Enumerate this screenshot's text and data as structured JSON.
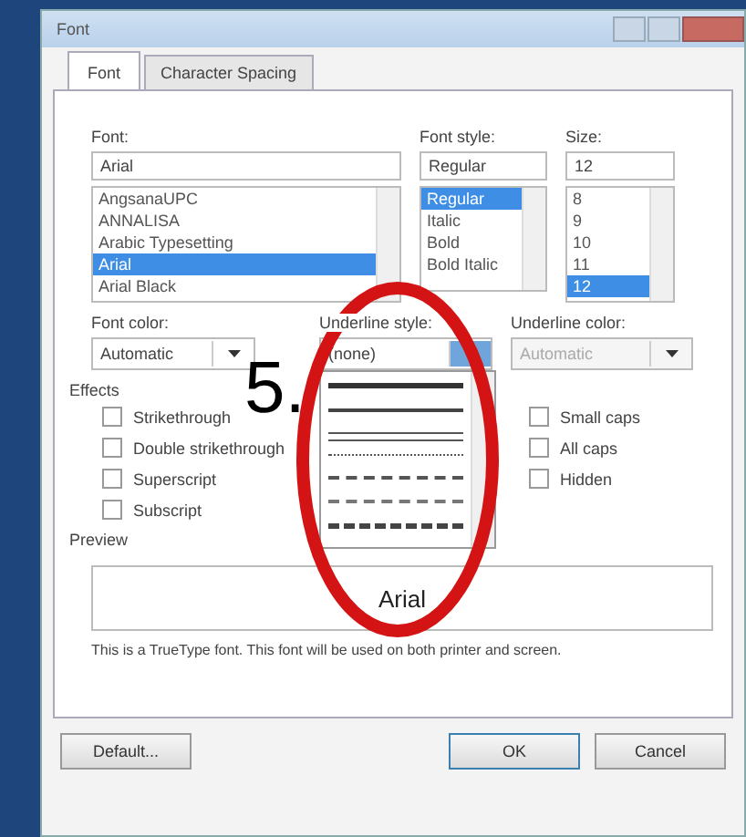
{
  "window": {
    "title": "Font"
  },
  "tabs": [
    {
      "label": "Font",
      "selected": true
    },
    {
      "label": "Character Spacing",
      "selected": false
    }
  ],
  "font": {
    "label": "Font:",
    "value": "Arial",
    "items": [
      {
        "label": "AngsanaUPC",
        "selected": false
      },
      {
        "label": "ANNALISA",
        "selected": false
      },
      {
        "label": "Arabic Typesetting",
        "selected": false
      },
      {
        "label": "Arial",
        "selected": true
      },
      {
        "label": "Arial Black",
        "selected": false
      }
    ]
  },
  "font_style": {
    "label": "Font style:",
    "value": "Regular",
    "items": [
      {
        "label": "Regular",
        "selected": true
      },
      {
        "label": "Italic",
        "selected": false
      },
      {
        "label": "Bold",
        "selected": false
      },
      {
        "label": "Bold Italic",
        "selected": false
      }
    ]
  },
  "size": {
    "label": "Size:",
    "value": "12",
    "items": [
      {
        "label": "8",
        "selected": false
      },
      {
        "label": "9",
        "selected": false
      },
      {
        "label": "10",
        "selected": false
      },
      {
        "label": "11",
        "selected": false
      },
      {
        "label": "12",
        "selected": true
      }
    ]
  },
  "font_color": {
    "label": "Font color:",
    "value": "Automatic",
    "disabled": false
  },
  "underline_style": {
    "label": "Underline style:",
    "value": "(none)",
    "expanded": true,
    "options": [
      {
        "kind": "heavy"
      },
      {
        "kind": "solid"
      },
      {
        "kind": "double"
      },
      {
        "kind": "dotted"
      },
      {
        "kind": "dashed"
      },
      {
        "kind": "dash-dot"
      },
      {
        "kind": "long-dash"
      }
    ]
  },
  "underline_color": {
    "label": "Underline color:",
    "value": "Automatic",
    "disabled": true
  },
  "effects": {
    "label": "Effects",
    "left": [
      {
        "label": "Strikethrough",
        "checked": false
      },
      {
        "label": "Double strikethrough",
        "checked": false
      },
      {
        "label": "Superscript",
        "checked": false
      },
      {
        "label": "Subscript",
        "checked": false
      }
    ],
    "right": [
      {
        "label": "Small caps",
        "checked": false
      },
      {
        "label": "All caps",
        "checked": false
      },
      {
        "label": "Hidden",
        "checked": false
      }
    ]
  },
  "preview": {
    "label": "Preview",
    "sample": "Arial",
    "note": "This is a TrueType font. This font will be used on both printer and screen."
  },
  "buttons": [
    {
      "label": "Default...",
      "kind": "default"
    },
    {
      "label": "OK",
      "kind": "primary"
    },
    {
      "label": "Cancel",
      "kind": "cancel"
    }
  ],
  "annotation": {
    "label": "5."
  }
}
